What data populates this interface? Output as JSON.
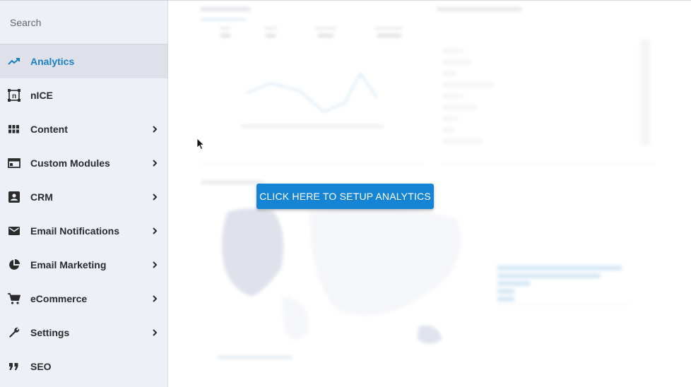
{
  "sidebar": {
    "search_placeholder": "Search",
    "items": [
      {
        "label": "Analytics",
        "icon": "trending-up-icon",
        "active": true,
        "has_children": false
      },
      {
        "label": "nICE",
        "icon": "nice-frame-icon",
        "active": false,
        "has_children": false
      },
      {
        "label": "Content",
        "icon": "grid-icon",
        "active": false,
        "has_children": true
      },
      {
        "label": "Custom Modules",
        "icon": "window-icon",
        "active": false,
        "has_children": true
      },
      {
        "label": "CRM",
        "icon": "contact-card-icon",
        "active": false,
        "has_children": true
      },
      {
        "label": "Email Notifications",
        "icon": "envelope-icon",
        "active": false,
        "has_children": true
      },
      {
        "label": "Email Marketing",
        "icon": "pie-chart-icon",
        "active": false,
        "has_children": true
      },
      {
        "label": "eCommerce",
        "icon": "cart-icon",
        "active": false,
        "has_children": true
      },
      {
        "label": "Settings",
        "icon": "wrench-icon",
        "active": false,
        "has_children": true
      },
      {
        "label": "SEO",
        "icon": "quote-icon",
        "active": false,
        "has_children": false
      }
    ]
  },
  "main": {
    "setup_button_label": "CLICK HERE TO SETUP ANALYTICS"
  },
  "colors": {
    "accent": "#1584d4",
    "active_text": "#1c7fc0",
    "sidebar_bg": "#eef0f8"
  }
}
